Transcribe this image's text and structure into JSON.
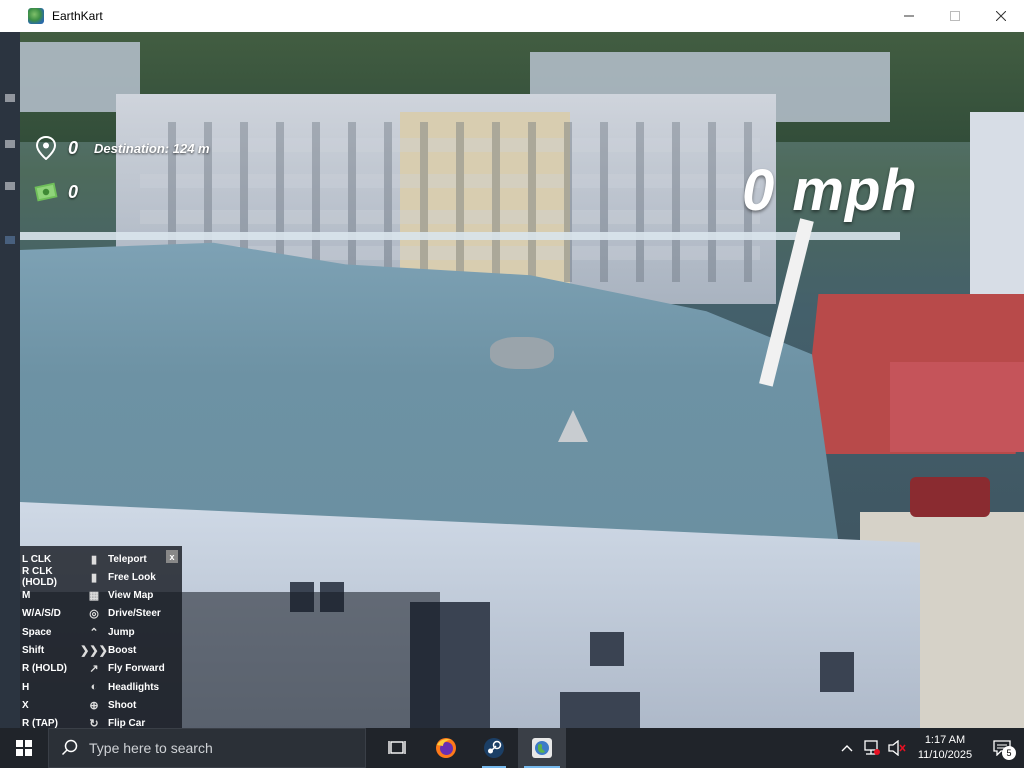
{
  "window": {
    "title": "EarthKart",
    "app_icon": "earthkart-globe-icon",
    "controls": [
      "minimize-icon",
      "maximize-icon",
      "close-icon"
    ]
  },
  "hud": {
    "destinations_count": "0",
    "destination_text": "Destination: 124 m",
    "money_count": "0",
    "speed": "0 mph"
  },
  "controls_panel": {
    "close_label": "x",
    "rows": [
      {
        "key": "L CLK",
        "icon": "left-mouse-icon",
        "action": "Teleport"
      },
      {
        "key": "R CLK (HOLD)",
        "icon": "right-mouse-icon",
        "action": "Free Look"
      },
      {
        "key": "M",
        "icon": "map-icon",
        "action": "View Map"
      },
      {
        "key": "W/A/S/D",
        "icon": "steering-wheel-icon",
        "action": "Drive/Steer"
      },
      {
        "key": "Space",
        "icon": "jump-icon",
        "action": "Jump"
      },
      {
        "key": "Shift",
        "icon": "boost-icon",
        "action": "Boost"
      },
      {
        "key": "R (HOLD)",
        "icon": "fly-icon",
        "action": "Fly Forward"
      },
      {
        "key": "H",
        "icon": "headlights-icon",
        "action": "Headlights"
      },
      {
        "key": "X",
        "icon": "shoot-icon",
        "action": "Shoot"
      },
      {
        "key": "R (TAP)",
        "icon": "flip-icon",
        "action": "Flip Car"
      }
    ]
  },
  "taskbar": {
    "search_placeholder": "Type here to search",
    "apps": [
      "task-view-icon",
      "firefox-icon",
      "steam-icon",
      "earthkart-icon"
    ],
    "time": "1:17 AM",
    "date": "11/10/2025",
    "notification_count": "5"
  },
  "colors": {
    "taskbar_bg": "#20242a",
    "accent": "#76b9ed",
    "roof": "#6d92a4",
    "red_roof": "#b84a4a"
  }
}
